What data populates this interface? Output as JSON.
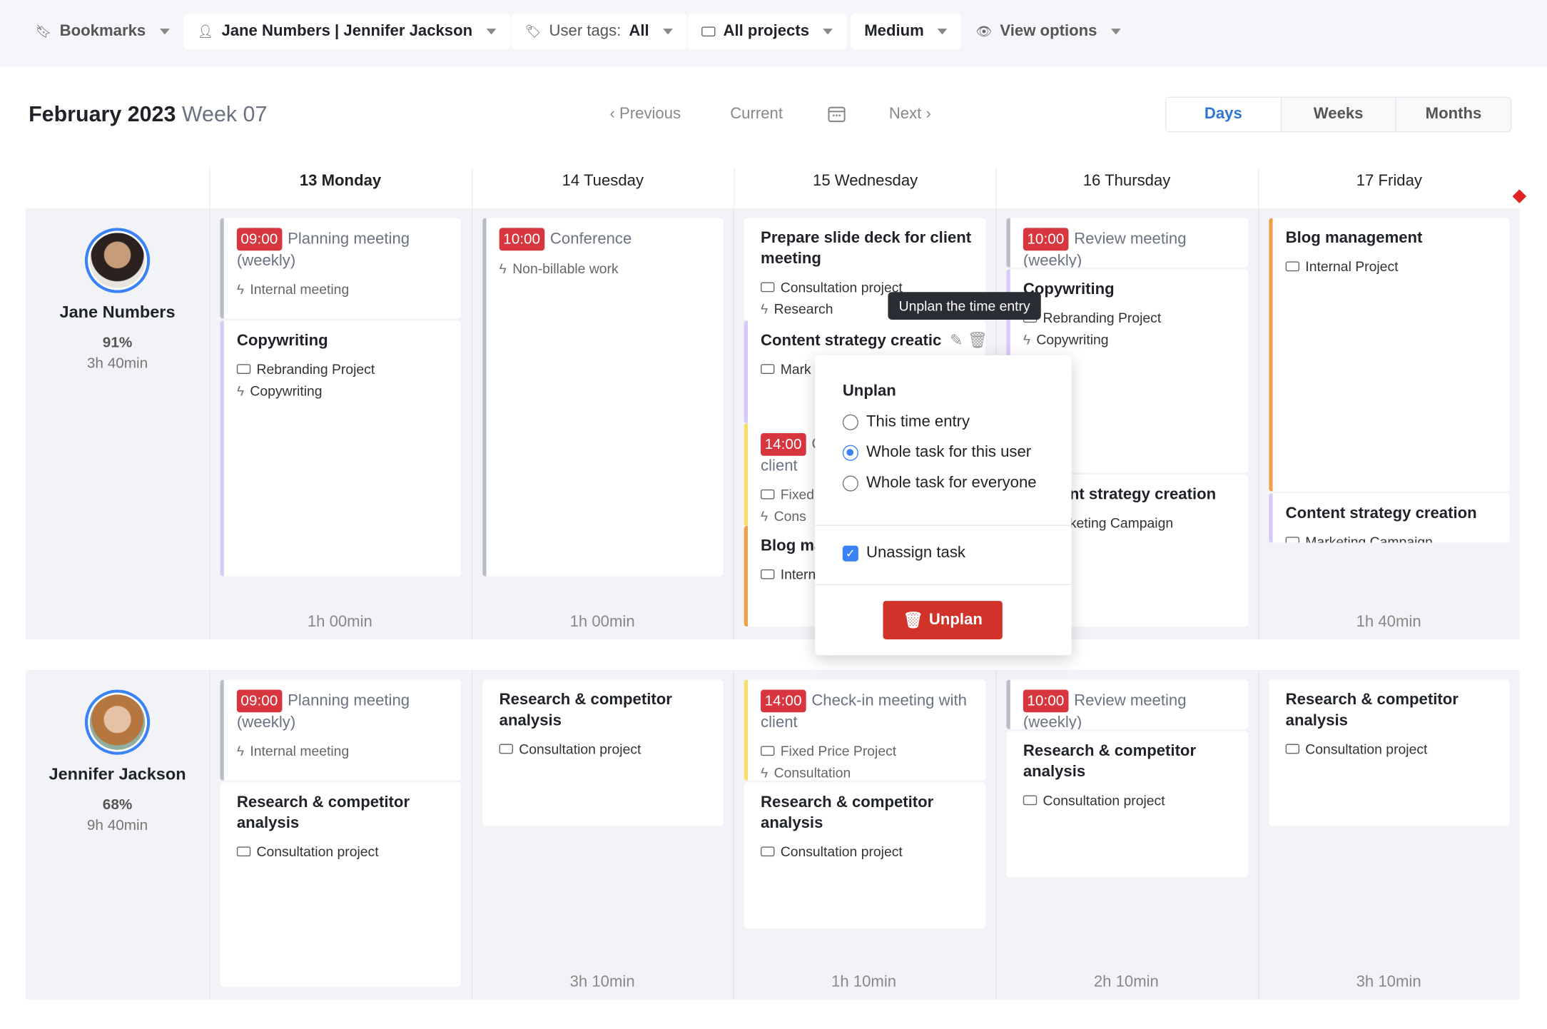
{
  "filters": {
    "bookmarks": "Bookmarks",
    "users": "Jane Numbers | Jennifer Jackson",
    "tags_label": "User tags:",
    "tags_value": "All",
    "projects": "All projects",
    "density": "Medium",
    "view": "View options"
  },
  "header": {
    "month": "February 2023",
    "week": "Week 07",
    "prev": "Previous",
    "current": "Current",
    "next": "Next"
  },
  "view_tabs": [
    "Days",
    "Weeks",
    "Months"
  ],
  "days": [
    "13 Monday",
    "14 Tuesday",
    "15 Wednesday",
    "16 Thursday",
    "17 Friday"
  ],
  "users": [
    {
      "name": "Jane Numbers",
      "pct": "91%",
      "hours": "3h 40min",
      "totals": [
        "1h 00min",
        "1h 00min",
        "",
        "",
        "1h 40min"
      ]
    },
    {
      "name": "Jennifer Jackson",
      "pct": "68%",
      "hours": "9h 40min",
      "totals": [
        "",
        "3h 10min",
        "1h 10min",
        "2h 10min",
        "3h 10min"
      ]
    }
  ],
  "cards": {
    "jane_mon_1": {
      "time": "09:00",
      "title": "Planning meeting (weekly)",
      "meta": "Internal meeting"
    },
    "jane_mon_2": {
      "title": "Copywriting",
      "project": "Rebranding Project",
      "task": "Copywriting"
    },
    "jane_tue_1": {
      "time": "10:00",
      "title": "Conference",
      "meta": "Non-billable work"
    },
    "jane_wed_1": {
      "title": "Prepare slide deck for client meeting",
      "project": "Consultation project",
      "task": "Research"
    },
    "jane_wed_2": {
      "title": "Content strategy creatic",
      "project": "Mark"
    },
    "jane_wed_3": {
      "time": "14:00",
      "title": "C",
      "title2": "client",
      "project": "Fixed",
      "task": "Cons"
    },
    "jane_wed_4": {
      "title": "Blog ma",
      "project": "Intern"
    },
    "jane_thu_1": {
      "time": "10:00",
      "title": "Review meeting (weekly)"
    },
    "jane_thu_2": {
      "title": "Copywriting",
      "project": "Rebranding Project",
      "task": "Copywriting"
    },
    "jane_thu_3": {
      "title": "nt strategy creation",
      "project": "keting Campaign"
    },
    "jane_fri_1": {
      "title": "Blog management",
      "project": "Internal Project"
    },
    "jane_fri_2": {
      "title": "Content strategy creation",
      "project": "Marketing Campaign"
    },
    "jen_mon_1": {
      "time": "09:00",
      "title": "Planning meeting (weekly)",
      "meta": "Internal meeting"
    },
    "jen_mon_2": {
      "title": "Research & competitor analysis",
      "project": "Consultation project"
    },
    "jen_tue_1": {
      "title": "Research & competitor analysis",
      "project": "Consultation project"
    },
    "jen_wed_1": {
      "time": "14:00",
      "title": "Check-in meeting with client",
      "project": "Fixed Price Project",
      "task": "Consultation"
    },
    "jen_wed_2": {
      "title": "Research & competitor analysis",
      "project": "Consultation project"
    },
    "jen_thu_1": {
      "time": "10:00",
      "title": "Review meeting (weekly)"
    },
    "jen_thu_2": {
      "title": "Research & competitor analysis",
      "project": "Consultation project"
    },
    "jen_fri_1": {
      "title": "Research & competitor analysis",
      "project": "Consultation project"
    }
  },
  "tooltip": "Unplan the time entry",
  "popup": {
    "title": "Unplan",
    "options": [
      "This time entry",
      "Whole task for this user",
      "Whole task for everyone"
    ],
    "selected": "Whole task for this user",
    "checkbox": "Unassign task",
    "checkbox_checked": true,
    "button": "Unplan"
  },
  "colors": {
    "accent": "#3b82f6",
    "time_badge": "#d8363f",
    "danger": "#d1332b",
    "meeting_bar": "#b8bdc6",
    "purple_bar": "#d9c9f5",
    "yellow_bar": "#f5dd6b",
    "orange_bar": "#f0a04b"
  }
}
